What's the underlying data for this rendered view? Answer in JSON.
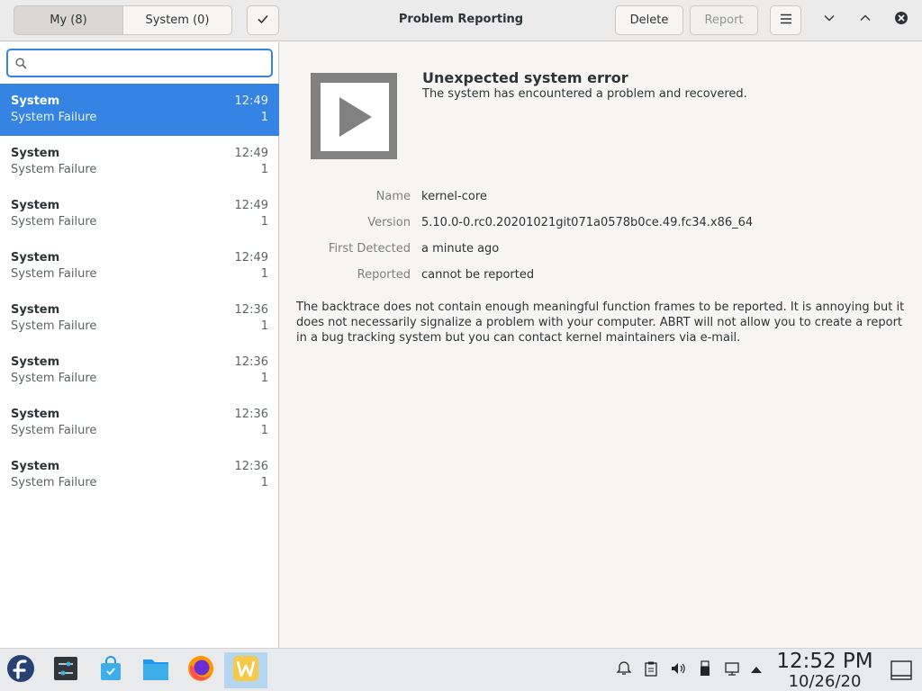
{
  "header": {
    "title": "Problem Reporting",
    "tabs": [
      {
        "label": "My (8)",
        "active": true
      },
      {
        "label": "System (0)",
        "active": false
      }
    ],
    "delete_label": "Delete",
    "report_label": "Report"
  },
  "sidebar": {
    "search_value": "",
    "problems": [
      {
        "source": "System",
        "type": "System Failure",
        "time": "12:49",
        "count": "1",
        "selected": true
      },
      {
        "source": "System",
        "type": "System Failure",
        "time": "12:49",
        "count": "1"
      },
      {
        "source": "System",
        "type": "System Failure",
        "time": "12:49",
        "count": "1"
      },
      {
        "source": "System",
        "type": "System Failure",
        "time": "12:49",
        "count": "1"
      },
      {
        "source": "System",
        "type": "System Failure",
        "time": "12:36",
        "count": "1"
      },
      {
        "source": "System",
        "type": "System Failure",
        "time": "12:36",
        "count": "1"
      },
      {
        "source": "System",
        "type": "System Failure",
        "time": "12:36",
        "count": "1"
      },
      {
        "source": "System",
        "type": "System Failure",
        "time": "12:36",
        "count": "1"
      }
    ]
  },
  "detail": {
    "title": "Unexpected system error",
    "subtitle": "The system has encountered a problem and recovered.",
    "fields": [
      {
        "key": "Name",
        "value": "kernel-core"
      },
      {
        "key": "Version",
        "value": "5.10.0-0.rc0.20201021git071a0578b0ce.49.fc34.x86_64"
      },
      {
        "key": "First Detected",
        "value": "a minute ago"
      },
      {
        "key": "Reported",
        "value": "cannot be reported"
      }
    ],
    "note": "The backtrace does not contain enough meaningful function frames to be reported. It is annoying but it does not necessarily signalize a problem with your computer. ABRT will not allow you to create a report in a bug tracking system but you can contact kernel maintainers via e-mail."
  },
  "taskbar": {
    "apps": [
      "fedora-icon",
      "settings-icon",
      "store-icon",
      "files-icon",
      "firefox-icon",
      "abrt-icon"
    ],
    "clock_time": "12:52 PM",
    "clock_date": "10/26/20"
  },
  "colors": {
    "accent": "#3584e4",
    "header_bg": "#ebebeb",
    "content_bg": "#f6f5f4"
  }
}
